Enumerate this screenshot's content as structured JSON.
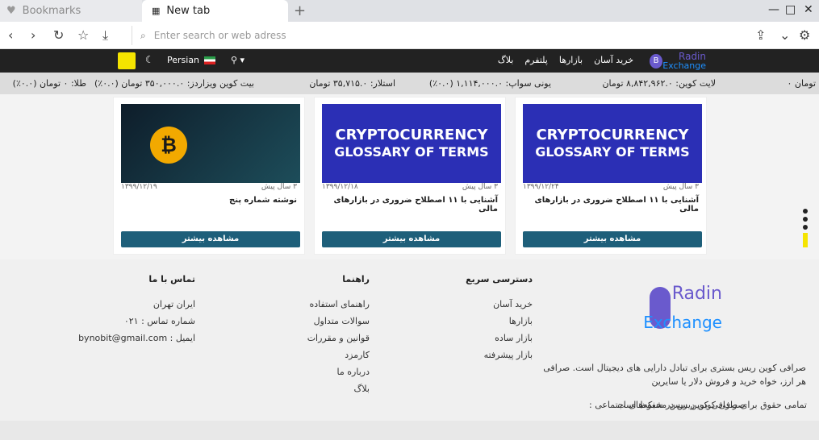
{
  "browser": {
    "tab1_label": "Bookmarks",
    "tab2_label": "New tab",
    "address_placeholder": "Enter search or web adress"
  },
  "nav": {
    "links": [
      "خرید آسان",
      "بازارها",
      "پلتفرم",
      "بلاگ"
    ],
    "logo_top": "Radin",
    "logo_bottom": "Exchange",
    "language": "Persian"
  },
  "ticker": [
    {
      "label": "تومان ۰",
      "color": "#222"
    },
    {
      "label": "لایت کوین: ۸,۸۴۲,۹۶۲.۰ تومان",
      "color": "#222"
    },
    {
      "label": "یونی سواپ: ۱,۱۱۴,۰۰۰.۰ (۰.۰٪)",
      "color": "#222"
    },
    {
      "label": "استلار: ۳۵,۷۱۵.۰ تومان",
      "color": "#222"
    },
    {
      "label": "بیت کوین ویزاردز: ۳۵۰,۰۰۰.۰ تومان (۰.۰٪)",
      "color": "#222"
    },
    {
      "label": "طلا: ۰ تومان (۰.۰٪)",
      "color": "#222"
    }
  ],
  "cards": [
    {
      "title": "آشنایی با ۱۱ اصطلاح ضروری در بازارهای مالی",
      "age": "۳ سال پیش",
      "date": "۱۳۹۹/۱۲/۲۴",
      "image_line1": "CRYPTOCURRENCY",
      "image_line2": "GLOSSARY OF TERMS",
      "button": "مشاهده بیشتر",
      "type": "glossary"
    },
    {
      "title": "آشنایی با ۱۱ اصطلاح ضروری در بازارهای مالی",
      "age": "۳ سال پیش",
      "date": "۱۳۹۹/۱۲/۱۸",
      "image_line1": "CRYPTOCURRENCY",
      "image_line2": "GLOSSARY OF TERMS",
      "button": "مشاهده بیشتر",
      "type": "glossary"
    },
    {
      "title": "نوشته شماره پنج",
      "age": "۳ سال پیش",
      "date": "۱۳۹۹/۱۲/۱۹",
      "image_line1": "",
      "image_line2": "",
      "button": "مشاهده بیشتر",
      "type": "bitcoin"
    }
  ],
  "footer": {
    "quick_title": "دسترسی سریع",
    "quick_links": [
      "خرید آسان",
      "بازارها",
      "بازار ساده",
      "بازار پیشرفته"
    ],
    "guide_title": "راهنما",
    "guide_links": [
      "راهنمای استفاده",
      "سوالات متداول",
      "قوانین و مقررات",
      "کارمزد",
      "درباره ما",
      "بلاگ"
    ],
    "contact_title": "تماس با ما",
    "contact_lines": [
      "ایران تهران",
      "شماره تماس : ۰۲۱",
      "ایمیل : bynobit@gmail.com"
    ],
    "logo_top": "Radin",
    "logo_bottom": "Exchange",
    "description": "صرافی کوین ریس بستری برای تبادل دارایی های دیجیتال است. صرافی هر ارز، خواه خرید و فروش دلار یا سایرین",
    "copyright": "تمامی حقوق برای صرافی کوین ریس محفوظ است",
    "social_label": "صرافی کوین ریس در شبکه‌های اجتماعی :"
  }
}
